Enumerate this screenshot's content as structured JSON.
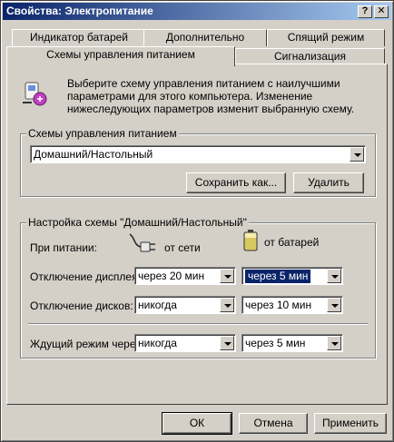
{
  "window": {
    "title": "Свойства: Электропитание",
    "help_glyph": "?",
    "close_glyph": "✕"
  },
  "tabs": {
    "row_back": [
      "Индикатор батарей",
      "Дополнительно",
      "Спящий режим"
    ],
    "row_front": [
      "Схемы управления питанием",
      "Сигнализация"
    ],
    "active": "Схемы управления питанием"
  },
  "intro": {
    "icon": "power-options-icon",
    "text": "Выберите схему управления питанием с наилучшими параметрами для этого компьютера. Изменение нижеследующих параметров изменит выбранную схему."
  },
  "schemes": {
    "legend": "Схемы управления питанием",
    "selected": "Домашний/Настольный",
    "save_label": "Сохранить как...",
    "delete_label": "Удалить"
  },
  "settings": {
    "legend": "Настройка схемы \"Домашний/Настольный\"",
    "power_label": "При питании:",
    "ac_label": "от сети",
    "battery_label": "от батарей",
    "rows": [
      {
        "label": "Отключение дисплея:",
        "ac": "через 20 мин",
        "dc": "через 5 мин"
      },
      {
        "label": "Отключение дисков:",
        "ac": "никогда",
        "dc": "через 10 мин"
      },
      {
        "label": "Ждущий режим через:",
        "ac": "никогда",
        "dc": "через 5 мин"
      }
    ]
  },
  "footer": {
    "ok_label": "ОК",
    "cancel_label": "Отмена",
    "apply_label": "Применить"
  }
}
